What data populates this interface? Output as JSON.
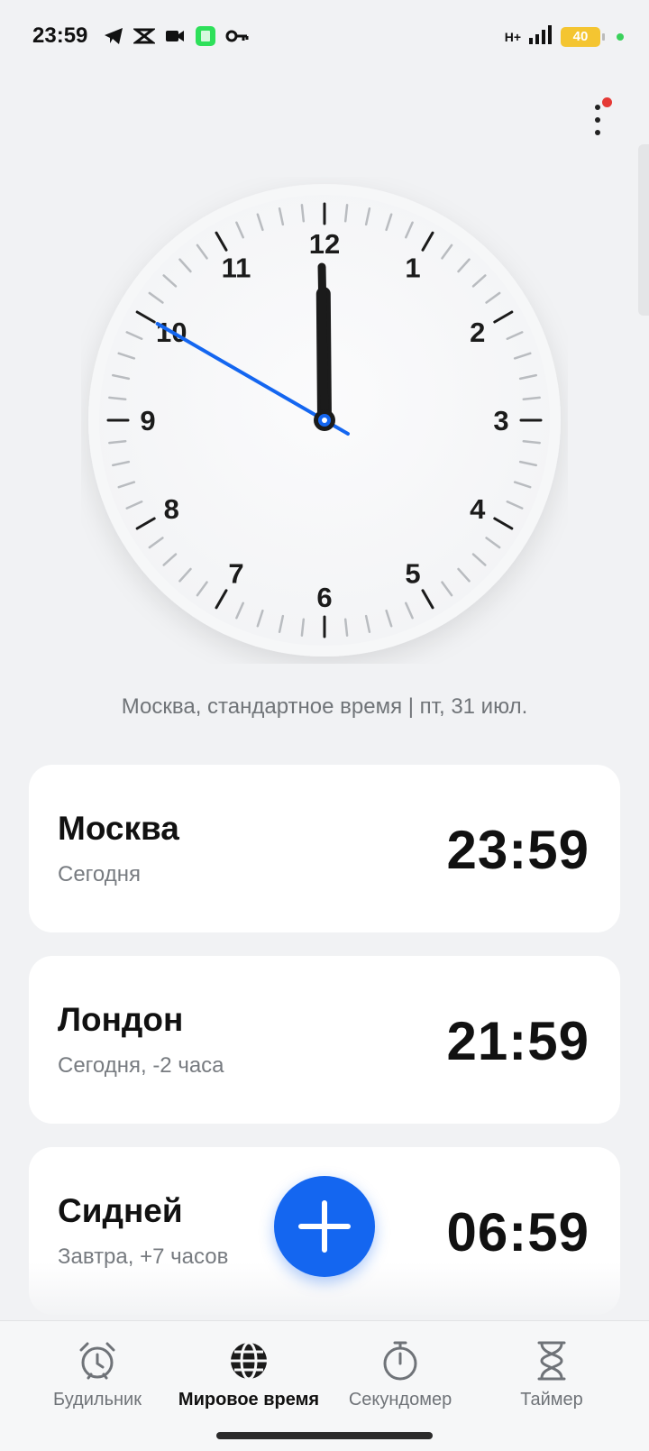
{
  "status_bar": {
    "time": "23:59",
    "network": "H+",
    "battery": "40",
    "icons_left": [
      "telegram-icon",
      "capcut-icon",
      "video-icon",
      "app-icon",
      "key-icon"
    ],
    "icons_right": [
      "signal-icon",
      "battery-icon"
    ]
  },
  "clock": {
    "hours": 23,
    "minutes": 59,
    "seconds": 50,
    "numbers": [
      "12",
      "1",
      "2",
      "3",
      "4",
      "5",
      "6",
      "7",
      "8",
      "9",
      "10",
      "11"
    ],
    "second_hand_color": "#1466f0"
  },
  "date_line": "Москва, стандартное время | пт, 31 июл.",
  "cities": [
    {
      "name": "Москва",
      "sub": "Сегодня",
      "time": "23:59"
    },
    {
      "name": "Лондон",
      "sub": "Сегодня, -2 часа",
      "time": "21:59"
    },
    {
      "name": "Сидней",
      "sub": "Завтра, +7 часов",
      "time": "06:59"
    }
  ],
  "fab": {
    "icon": "plus-icon",
    "color": "#1466f0"
  },
  "nav": {
    "alarm": "Будильник",
    "world_clock": "Мировое время",
    "stopwatch": "Секундомер",
    "timer": "Таймер"
  },
  "colors": {
    "background": "#f1f2f4",
    "accent": "#1466f0",
    "badge": "#e53935"
  }
}
